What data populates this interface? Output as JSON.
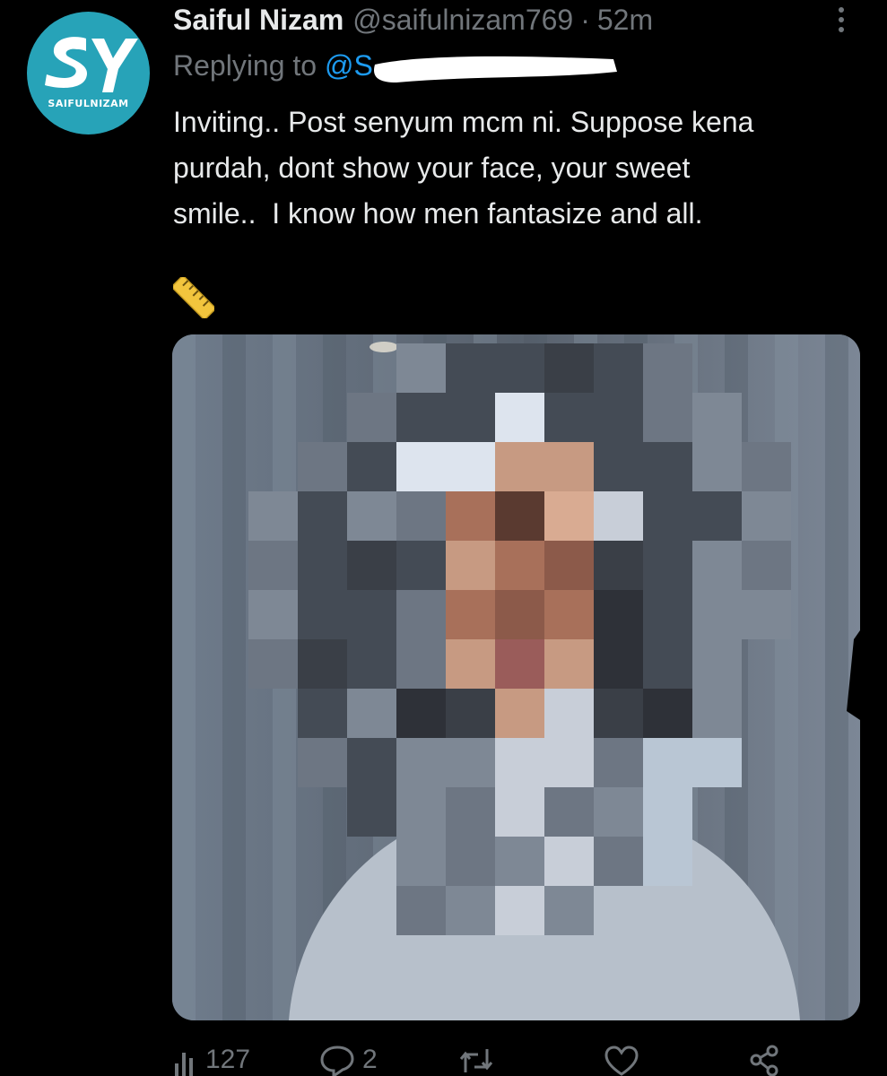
{
  "author": {
    "name": "Saiful Nizam",
    "handle": "@saifulnizam769",
    "separator": "·",
    "time": "52m",
    "avatar_caption": "SAIFULNIZAM",
    "avatar_letters": "SY"
  },
  "reply": {
    "label": "Replying to",
    "mention_visible": "@S"
  },
  "tweet": {
    "text": "Inviting.. Post senyum mcm ni. Suppose kena\npurdah, dont show your face, your sweet\nsmile..  I know how men fantasize and all.",
    "emoji_icon": "straight-ruler-icon"
  },
  "actions": {
    "views_count": "127",
    "replies_count": "2"
  },
  "colors": {
    "background": "#000000",
    "text": "#e7e9ea",
    "muted": "#71767b",
    "link": "#1d9bf0",
    "avatar_bg": "#27a3b8"
  }
}
